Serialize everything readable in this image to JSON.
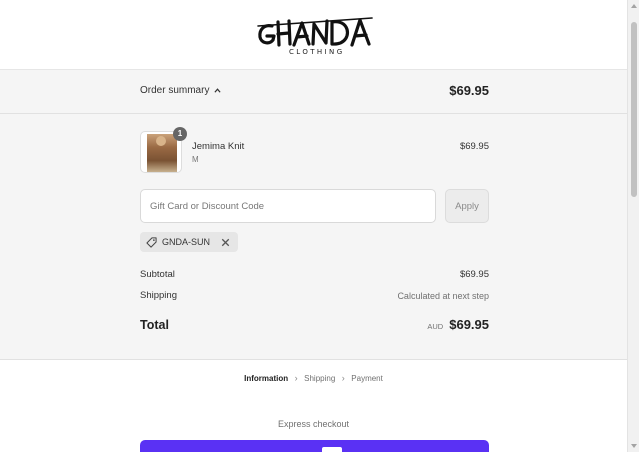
{
  "brand": {
    "logo_text": "GHANDA",
    "logo_subtext": "CLOTHING"
  },
  "summary": {
    "toggle_label": "Order summary",
    "total": "$69.95"
  },
  "item": {
    "quantity": "1",
    "name": "Jemima Knit",
    "variant": "M",
    "price": "$69.95"
  },
  "discount": {
    "placeholder": "Gift Card or Discount Code",
    "apply_label": "Apply",
    "applied_code": "GNDA-SUN"
  },
  "totals": {
    "subtotal_label": "Subtotal",
    "subtotal_value": "$69.95",
    "shipping_label": "Shipping",
    "shipping_value": "Calculated at next step",
    "total_label": "Total",
    "currency": "AUD",
    "total_value": "$69.95"
  },
  "breadcrumb": {
    "steps": [
      "Information",
      "Shipping",
      "Payment"
    ]
  },
  "express": {
    "label": "Express checkout"
  },
  "colors": {
    "shop_pay": "#5a31f4",
    "summary_bg": "#f5f5f5"
  },
  "icons": [
    "chevron-up-icon",
    "tag-icon",
    "close-icon",
    "chevron-right-icon"
  ]
}
